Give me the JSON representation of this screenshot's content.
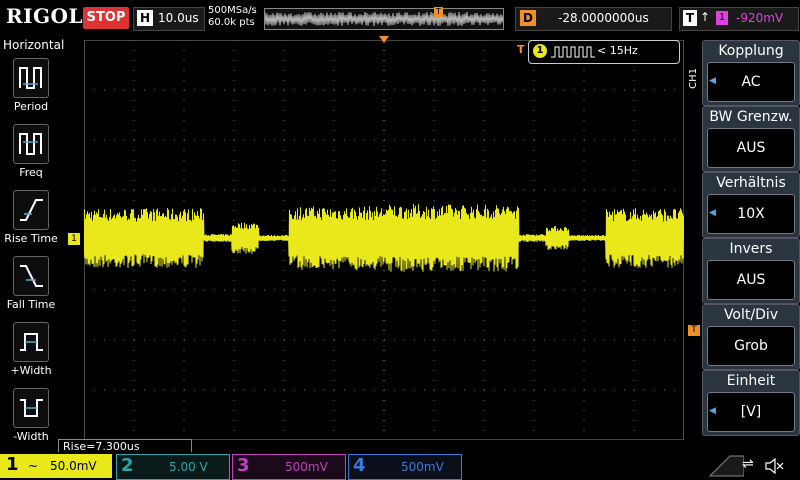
{
  "header": {
    "brand": "RIGOL",
    "run_state": "STOP",
    "timebase_label": "H",
    "timebase_value": "10.0us",
    "sample_rate": "500MSa/s",
    "memory_depth": "60.0k pts",
    "trigger_pos_marker": "T",
    "delay_label": "D",
    "delay_value": "-28.0000000us",
    "trigger_label": "T",
    "trigger_edge": "↑",
    "trigger_source": "1",
    "trigger_level": "-920mV"
  },
  "left_menu": {
    "title": "Horizontal",
    "items": [
      {
        "label": "Period",
        "icon": "period-icon"
      },
      {
        "label": "Freq",
        "icon": "freq-icon"
      },
      {
        "label": "Rise Time",
        "icon": "rise-time-icon"
      },
      {
        "label": "Fall Time",
        "icon": "fall-time-icon"
      },
      {
        "label": "+Width",
        "icon": "pos-width-icon"
      },
      {
        "label": "-Width",
        "icon": "neg-width-icon"
      }
    ]
  },
  "measurement": {
    "channel": "1",
    "freq_value": "< 15Hz",
    "rise_readout": "Rise=7.300us"
  },
  "markers": {
    "ch1_offset": "1",
    "trig_level": "T"
  },
  "right_menu": {
    "channel_label": "CH1",
    "items": [
      {
        "title": "Kopplung",
        "value": "AC",
        "arrow": true
      },
      {
        "title": "BW Grenzw.",
        "value": "AUS",
        "arrow": false
      },
      {
        "title": "Verhältnis",
        "value": "10X",
        "arrow": true
      },
      {
        "title": "Invers",
        "value": "AUS",
        "arrow": false
      },
      {
        "title": "Volt/Div",
        "value": "Grob",
        "arrow": false
      },
      {
        "title": "Einheit",
        "value": "[V]",
        "arrow": true
      }
    ]
  },
  "channels": [
    {
      "num": "1",
      "symbol": "~",
      "scale": "50.0mV",
      "color": "#e8e81a"
    },
    {
      "num": "2",
      "symbol": "",
      "scale": "5.00 V",
      "color": "#2aa8a8"
    },
    {
      "num": "3",
      "symbol": "",
      "scale": "500mV",
      "color": "#c040c0"
    },
    {
      "num": "4",
      "symbol": "",
      "scale": "500mV",
      "color": "#3a7ad8"
    }
  ],
  "colors": {
    "ch1": "#e8e81a",
    "trigger": "#f0902a",
    "grid": "#777777",
    "stop": "#dd3333"
  }
}
